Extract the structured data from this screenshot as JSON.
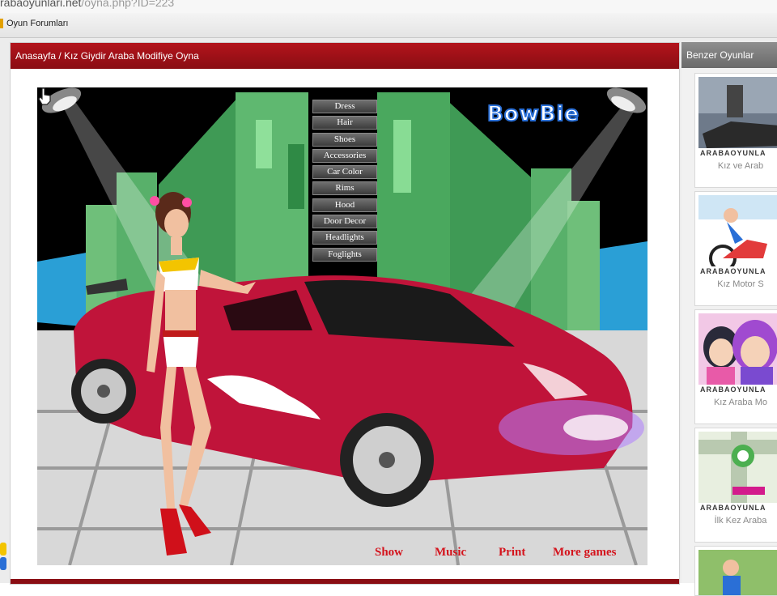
{
  "browser": {
    "url_host": "rabaoyunlari.net",
    "url_path": "/oyna.php?ID=223"
  },
  "bookmarks": {
    "item": "Oyun Forumları"
  },
  "main": {
    "breadcrumb": "Anasayfa / Kız Giydir Araba Modifiye Oyna"
  },
  "game": {
    "menu": [
      "Dress",
      "Hair",
      "Shoes",
      "Accessories",
      "Car Color",
      "Rims",
      "Hood",
      "Door Decor",
      "Headlights",
      "Foglights"
    ],
    "logo": "BowBie",
    "links": {
      "show": "Show",
      "music": "Music",
      "print": "Print",
      "more": "More games"
    }
  },
  "sidebar": {
    "title": "Benzer Oyunlar",
    "games": [
      {
        "caption": "Kız ve Arab",
        "watermark": "ARABAOYUNLA"
      },
      {
        "caption": "Kız Motor S",
        "watermark": "ARABAOYUNLA"
      },
      {
        "caption": "Kız Araba Mo",
        "watermark": "ARABAOYUNLA"
      },
      {
        "caption": "İlk Kez Araba",
        "watermark": "ARABAOYUNLA"
      }
    ]
  },
  "colors": {
    "header_red": "#a01018",
    "link_red": "#d4131c",
    "car_red": "#c0143a"
  }
}
